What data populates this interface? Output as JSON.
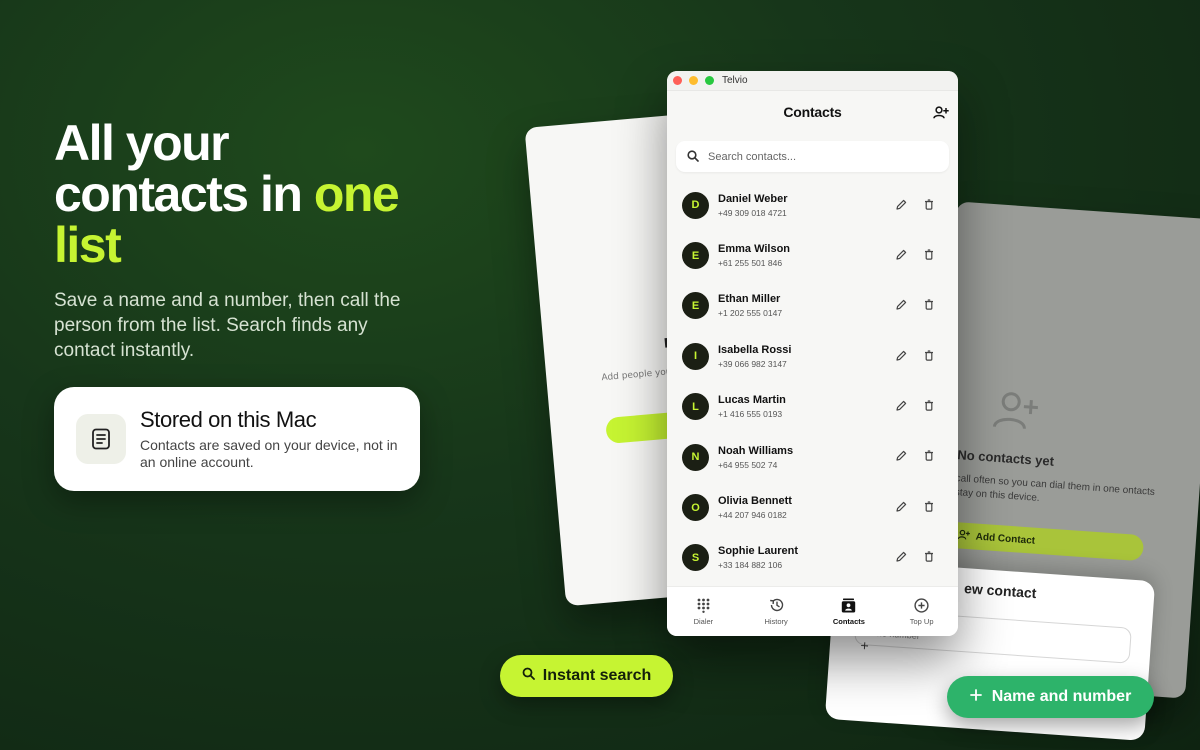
{
  "hero": {
    "headline_line1": "All your",
    "headline_line2_a": "contacts in ",
    "headline_line2_b": "one",
    "headline_line3": "list",
    "subtext": "Save a name and a number, then call the person from the list. Search finds any contact instantly."
  },
  "feature": {
    "icon": "document-icon",
    "title": "Stored on this Mac",
    "description": "Contacts are saved on your device, not in an online account."
  },
  "bg_left_card": {
    "title_fragment": "No",
    "text_fragment": "Add people you c... tap. Co"
  },
  "bg_right_card": {
    "empty_title": "No contacts yet",
    "empty_desc": "call often so you can dial them in one ontacts stay on this device.",
    "add_button": "Add Contact"
  },
  "new_contact_sheet": {
    "title": "ew contact",
    "phone_label": "Phone number",
    "prefix": "+"
  },
  "window": {
    "app_name": "Telvio",
    "page_title": "Contacts",
    "search_placeholder": "Search contacts...",
    "contacts": [
      {
        "initial": "D",
        "name": "Daniel Weber",
        "phone": "+49 309 018 4721"
      },
      {
        "initial": "E",
        "name": "Emma Wilson",
        "phone": "+61 255 501 846"
      },
      {
        "initial": "E",
        "name": "Ethan Miller",
        "phone": "+1 202 555 0147"
      },
      {
        "initial": "I",
        "name": "Isabella Rossi",
        "phone": "+39 066 982 3147"
      },
      {
        "initial": "L",
        "name": "Lucas Martin",
        "phone": "+1 416 555 0193"
      },
      {
        "initial": "N",
        "name": "Noah Williams",
        "phone": "+64 955 502 74"
      },
      {
        "initial": "O",
        "name": "Olivia Bennett",
        "phone": "+44 207 946 0182"
      },
      {
        "initial": "S",
        "name": "Sophie Laurent",
        "phone": "+33 184 882 106"
      }
    ],
    "tabs": [
      {
        "label": "Dialer",
        "icon": "dialpad-icon"
      },
      {
        "label": "History",
        "icon": "history-icon"
      },
      {
        "label": "Contacts",
        "icon": "contacts-icon",
        "active": true
      },
      {
        "label": "Top Up",
        "icon": "plus-circle-icon"
      }
    ]
  },
  "pills": {
    "search": "Instant search",
    "name_number": "Name and number"
  },
  "colors": {
    "accent": "#c6f432",
    "green_pill": "#2db36a",
    "background": "#17361a"
  }
}
